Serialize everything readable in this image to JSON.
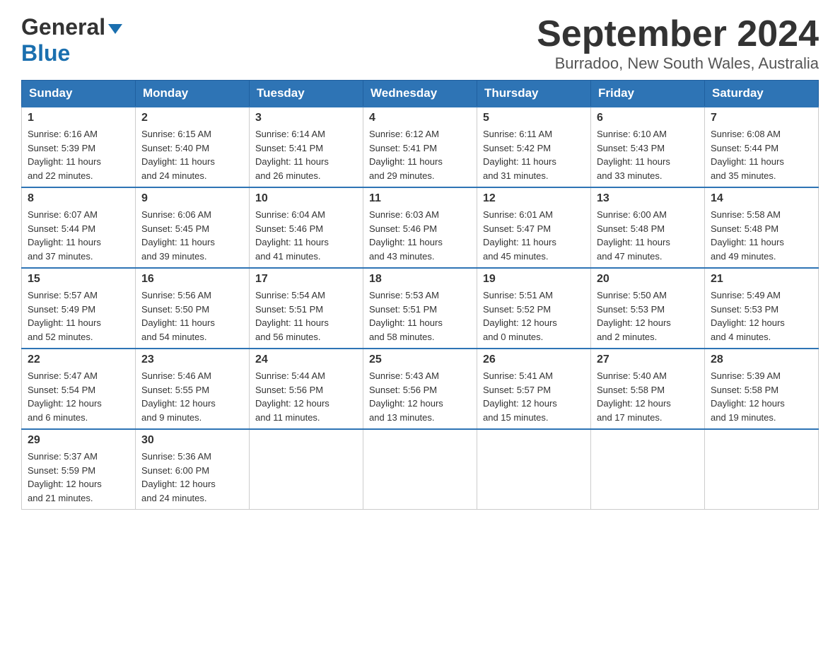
{
  "header": {
    "logo_line1": "General",
    "logo_line2": "Blue",
    "month_year": "September 2024",
    "location": "Burradoo, New South Wales, Australia"
  },
  "weekdays": [
    "Sunday",
    "Monday",
    "Tuesday",
    "Wednesday",
    "Thursday",
    "Friday",
    "Saturday"
  ],
  "weeks": [
    [
      {
        "day": "1",
        "info": "Sunrise: 6:16 AM\nSunset: 5:39 PM\nDaylight: 11 hours\nand 22 minutes."
      },
      {
        "day": "2",
        "info": "Sunrise: 6:15 AM\nSunset: 5:40 PM\nDaylight: 11 hours\nand 24 minutes."
      },
      {
        "day": "3",
        "info": "Sunrise: 6:14 AM\nSunset: 5:41 PM\nDaylight: 11 hours\nand 26 minutes."
      },
      {
        "day": "4",
        "info": "Sunrise: 6:12 AM\nSunset: 5:41 PM\nDaylight: 11 hours\nand 29 minutes."
      },
      {
        "day": "5",
        "info": "Sunrise: 6:11 AM\nSunset: 5:42 PM\nDaylight: 11 hours\nand 31 minutes."
      },
      {
        "day": "6",
        "info": "Sunrise: 6:10 AM\nSunset: 5:43 PM\nDaylight: 11 hours\nand 33 minutes."
      },
      {
        "day": "7",
        "info": "Sunrise: 6:08 AM\nSunset: 5:44 PM\nDaylight: 11 hours\nand 35 minutes."
      }
    ],
    [
      {
        "day": "8",
        "info": "Sunrise: 6:07 AM\nSunset: 5:44 PM\nDaylight: 11 hours\nand 37 minutes."
      },
      {
        "day": "9",
        "info": "Sunrise: 6:06 AM\nSunset: 5:45 PM\nDaylight: 11 hours\nand 39 minutes."
      },
      {
        "day": "10",
        "info": "Sunrise: 6:04 AM\nSunset: 5:46 PM\nDaylight: 11 hours\nand 41 minutes."
      },
      {
        "day": "11",
        "info": "Sunrise: 6:03 AM\nSunset: 5:46 PM\nDaylight: 11 hours\nand 43 minutes."
      },
      {
        "day": "12",
        "info": "Sunrise: 6:01 AM\nSunset: 5:47 PM\nDaylight: 11 hours\nand 45 minutes."
      },
      {
        "day": "13",
        "info": "Sunrise: 6:00 AM\nSunset: 5:48 PM\nDaylight: 11 hours\nand 47 minutes."
      },
      {
        "day": "14",
        "info": "Sunrise: 5:58 AM\nSunset: 5:48 PM\nDaylight: 11 hours\nand 49 minutes."
      }
    ],
    [
      {
        "day": "15",
        "info": "Sunrise: 5:57 AM\nSunset: 5:49 PM\nDaylight: 11 hours\nand 52 minutes."
      },
      {
        "day": "16",
        "info": "Sunrise: 5:56 AM\nSunset: 5:50 PM\nDaylight: 11 hours\nand 54 minutes."
      },
      {
        "day": "17",
        "info": "Sunrise: 5:54 AM\nSunset: 5:51 PM\nDaylight: 11 hours\nand 56 minutes."
      },
      {
        "day": "18",
        "info": "Sunrise: 5:53 AM\nSunset: 5:51 PM\nDaylight: 11 hours\nand 58 minutes."
      },
      {
        "day": "19",
        "info": "Sunrise: 5:51 AM\nSunset: 5:52 PM\nDaylight: 12 hours\nand 0 minutes."
      },
      {
        "day": "20",
        "info": "Sunrise: 5:50 AM\nSunset: 5:53 PM\nDaylight: 12 hours\nand 2 minutes."
      },
      {
        "day": "21",
        "info": "Sunrise: 5:49 AM\nSunset: 5:53 PM\nDaylight: 12 hours\nand 4 minutes."
      }
    ],
    [
      {
        "day": "22",
        "info": "Sunrise: 5:47 AM\nSunset: 5:54 PM\nDaylight: 12 hours\nand 6 minutes."
      },
      {
        "day": "23",
        "info": "Sunrise: 5:46 AM\nSunset: 5:55 PM\nDaylight: 12 hours\nand 9 minutes."
      },
      {
        "day": "24",
        "info": "Sunrise: 5:44 AM\nSunset: 5:56 PM\nDaylight: 12 hours\nand 11 minutes."
      },
      {
        "day": "25",
        "info": "Sunrise: 5:43 AM\nSunset: 5:56 PM\nDaylight: 12 hours\nand 13 minutes."
      },
      {
        "day": "26",
        "info": "Sunrise: 5:41 AM\nSunset: 5:57 PM\nDaylight: 12 hours\nand 15 minutes."
      },
      {
        "day": "27",
        "info": "Sunrise: 5:40 AM\nSunset: 5:58 PM\nDaylight: 12 hours\nand 17 minutes."
      },
      {
        "day": "28",
        "info": "Sunrise: 5:39 AM\nSunset: 5:58 PM\nDaylight: 12 hours\nand 19 minutes."
      }
    ],
    [
      {
        "day": "29",
        "info": "Sunrise: 5:37 AM\nSunset: 5:59 PM\nDaylight: 12 hours\nand 21 minutes."
      },
      {
        "day": "30",
        "info": "Sunrise: 5:36 AM\nSunset: 6:00 PM\nDaylight: 12 hours\nand 24 minutes."
      },
      {
        "day": "",
        "info": ""
      },
      {
        "day": "",
        "info": ""
      },
      {
        "day": "",
        "info": ""
      },
      {
        "day": "",
        "info": ""
      },
      {
        "day": "",
        "info": ""
      }
    ]
  ]
}
